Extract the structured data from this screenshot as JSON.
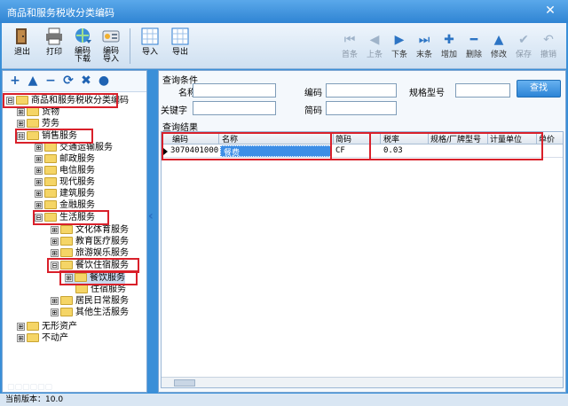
{
  "window": {
    "title": "商品和服务税收分类编码"
  },
  "toolbar": {
    "left_buttons": [
      {
        "label": "退出",
        "icon": "exit-door-icon"
      },
      {
        "label": "打印",
        "icon": "printer-icon"
      },
      {
        "label": "编码\n下载",
        "icon": "globe-download-icon"
      },
      {
        "label": "编码\n导入",
        "icon": "import-code-icon"
      },
      {
        "label": "导入",
        "icon": "spreadsheet-import-icon"
      },
      {
        "label": "导出",
        "icon": "spreadsheet-export-icon"
      }
    ],
    "nav_buttons": [
      {
        "label": "首条",
        "glyph": "⏮",
        "enabled": false
      },
      {
        "label": "上条",
        "glyph": "◀",
        "enabled": false
      },
      {
        "label": "下条",
        "glyph": "▶",
        "enabled": true
      },
      {
        "label": "末条",
        "glyph": "⏭",
        "enabled": true
      },
      {
        "label": "增加",
        "glyph": "✚",
        "enabled": true
      },
      {
        "label": "删除",
        "glyph": "━",
        "enabled": true
      },
      {
        "label": "修改",
        "glyph": "▲",
        "enabled": true
      },
      {
        "label": "保存",
        "glyph": "✔",
        "enabled": false
      },
      {
        "label": "撤销",
        "glyph": "↶",
        "enabled": false
      }
    ]
  },
  "tree": {
    "tools": [
      "+",
      "▲",
      "−",
      "⟳",
      "✖",
      "●"
    ],
    "nodes": [
      {
        "label": "商品和服务税收分类编码",
        "expander": "⊟"
      },
      {
        "label": "货物",
        "expander": "⊞"
      },
      {
        "label": "劳务",
        "expander": "⊞"
      },
      {
        "label": "销售服务",
        "expander": "⊟"
      },
      {
        "label": "交通运输服务",
        "expander": "⊞"
      },
      {
        "label": "邮政服务",
        "expander": "⊞"
      },
      {
        "label": "电信服务",
        "expander": "⊞"
      },
      {
        "label": "现代服务",
        "expander": "⊞"
      },
      {
        "label": "建筑服务",
        "expander": "⊞"
      },
      {
        "label": "金融服务",
        "expander": "⊞"
      },
      {
        "label": "生活服务",
        "expander": "⊟"
      },
      {
        "label": "文化体育服务",
        "expander": "⊞"
      },
      {
        "label": "教育医疗服务",
        "expander": "⊞"
      },
      {
        "label": "旅游娱乐服务",
        "expander": "⊞"
      },
      {
        "label": "餐饮住宿服务",
        "expander": "⊟"
      },
      {
        "label": "餐饮服务",
        "expander": "⊞"
      },
      {
        "label": "住宿服务",
        "expander": ""
      },
      {
        "label": "居民日常服务",
        "expander": "⊞"
      },
      {
        "label": "其他生活服务",
        "expander": "⊞"
      },
      {
        "label": "无形资产",
        "expander": "⊞"
      },
      {
        "label": "不动产",
        "expander": "⊞"
      }
    ]
  },
  "query": {
    "section_title": "查询条件",
    "name_label": "名称",
    "code_label": "编码",
    "spec_label": "规格型号",
    "keyword_label": "关键字",
    "short_code_label": "简码",
    "name_value": "",
    "code_value": "",
    "spec_value": "",
    "keyword_value": "",
    "short_code_value": "",
    "search_button": "查找"
  },
  "results": {
    "section_title": "查询结果",
    "columns": [
      "编码",
      "名称",
      "简码",
      "税率",
      "规格/厂牌型号",
      "计量单位",
      "单价"
    ],
    "rows": [
      {
        "code": "3070401000",
        "name": "餐费",
        "short_code": "CF",
        "tax_rate": "0.03",
        "spec": "",
        "unit": "",
        "price": ""
      }
    ]
  },
  "status": {
    "version_text": "当前版本：10.0"
  },
  "colors": {
    "highlight_red": "#d9202a",
    "selection_blue": "#3d8ee6",
    "title_blue": "#2f84d3"
  }
}
